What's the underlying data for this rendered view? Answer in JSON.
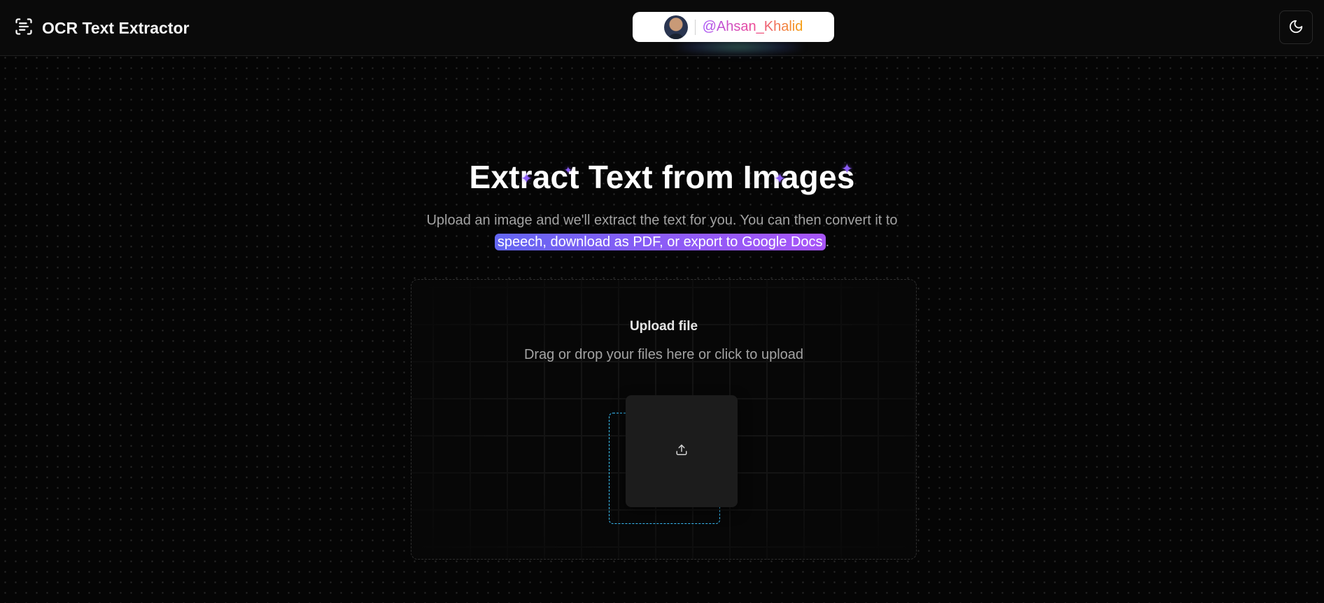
{
  "header": {
    "app_title": "OCR Text Extractor",
    "brand_icon": "scan-text-icon",
    "profile": {
      "handle": "@Ahsan_Khalid",
      "avatar": "user-avatar"
    },
    "theme_toggle_icon": "moon-icon"
  },
  "hero": {
    "title": "Extract Text from Images",
    "subtitle_plain": "Upload an image and we'll extract the text for you. You can then convert it to",
    "subtitle_highlight": "speech, download as PDF, or export to Google Docs",
    "subtitle_end": "."
  },
  "upload": {
    "title": "Upload file",
    "description": "Drag or drop your files here or click to upload",
    "icon": "upload-icon"
  },
  "colors": {
    "background": "#050505",
    "highlight_start": "#6366f1",
    "highlight_end": "#a855f7",
    "sparkle": "#8b5cf6",
    "dropzone_outline": "#38bdf8"
  }
}
